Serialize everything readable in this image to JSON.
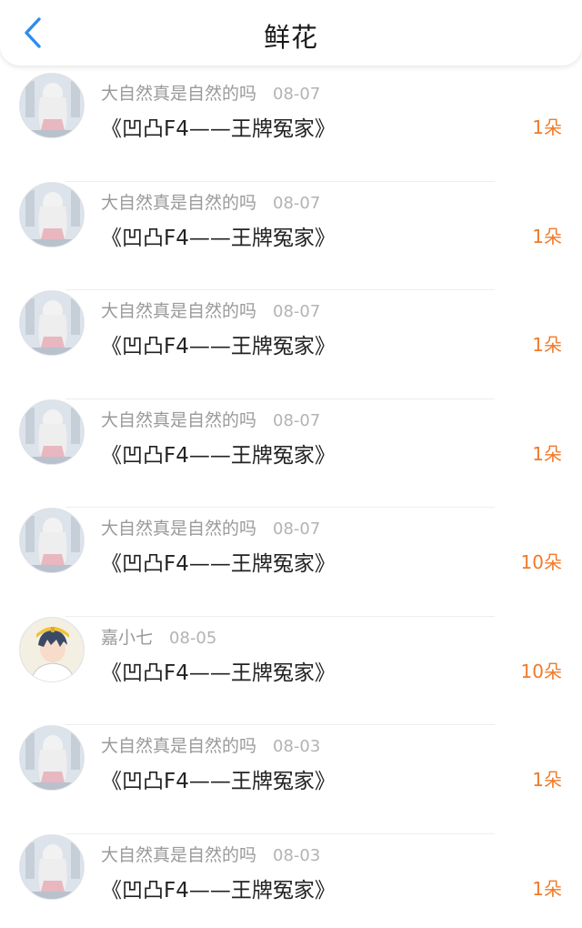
{
  "header": {
    "title": "鲜花",
    "back_icon": "chevron-left-icon",
    "accent_color": "#2f8bf0"
  },
  "colors": {
    "flower_count": "#f07a2a",
    "username": "#9a9a9a",
    "date": "#b3b3b3",
    "title_text": "#222222"
  },
  "records": [
    {
      "user": "大自然真是自然的吗",
      "date": "08-07",
      "title": "《凹凸F4——王牌冤家》",
      "count": "1朵",
      "avatar": "girl-white-hair-avatar"
    },
    {
      "user": "大自然真是自然的吗",
      "date": "08-07",
      "title": "《凹凸F4——王牌冤家》",
      "count": "1朵",
      "avatar": "girl-white-hair-avatar"
    },
    {
      "user": "大自然真是自然的吗",
      "date": "08-07",
      "title": "《凹凸F4——王牌冤家》",
      "count": "1朵",
      "avatar": "girl-white-hair-avatar"
    },
    {
      "user": "大自然真是自然的吗",
      "date": "08-07",
      "title": "《凹凸F4——王牌冤家》",
      "count": "1朵",
      "avatar": "girl-white-hair-avatar"
    },
    {
      "user": "大自然真是自然的吗",
      "date": "08-07",
      "title": "《凹凸F4——王牌冤家》",
      "count": "10朵",
      "avatar": "girl-white-hair-avatar"
    },
    {
      "user": "嘉小七",
      "date": "08-05",
      "title": "《凹凸F4——王牌冤家》",
      "count": "10朵",
      "avatar": "anime-boy-avatar"
    },
    {
      "user": "大自然真是自然的吗",
      "date": "08-03",
      "title": "《凹凸F4——王牌冤家》",
      "count": "1朵",
      "avatar": "girl-white-hair-avatar"
    },
    {
      "user": "大自然真是自然的吗",
      "date": "08-03",
      "title": "《凹凸F4——王牌冤家》",
      "count": "1朵",
      "avatar": "girl-white-hair-avatar"
    }
  ]
}
